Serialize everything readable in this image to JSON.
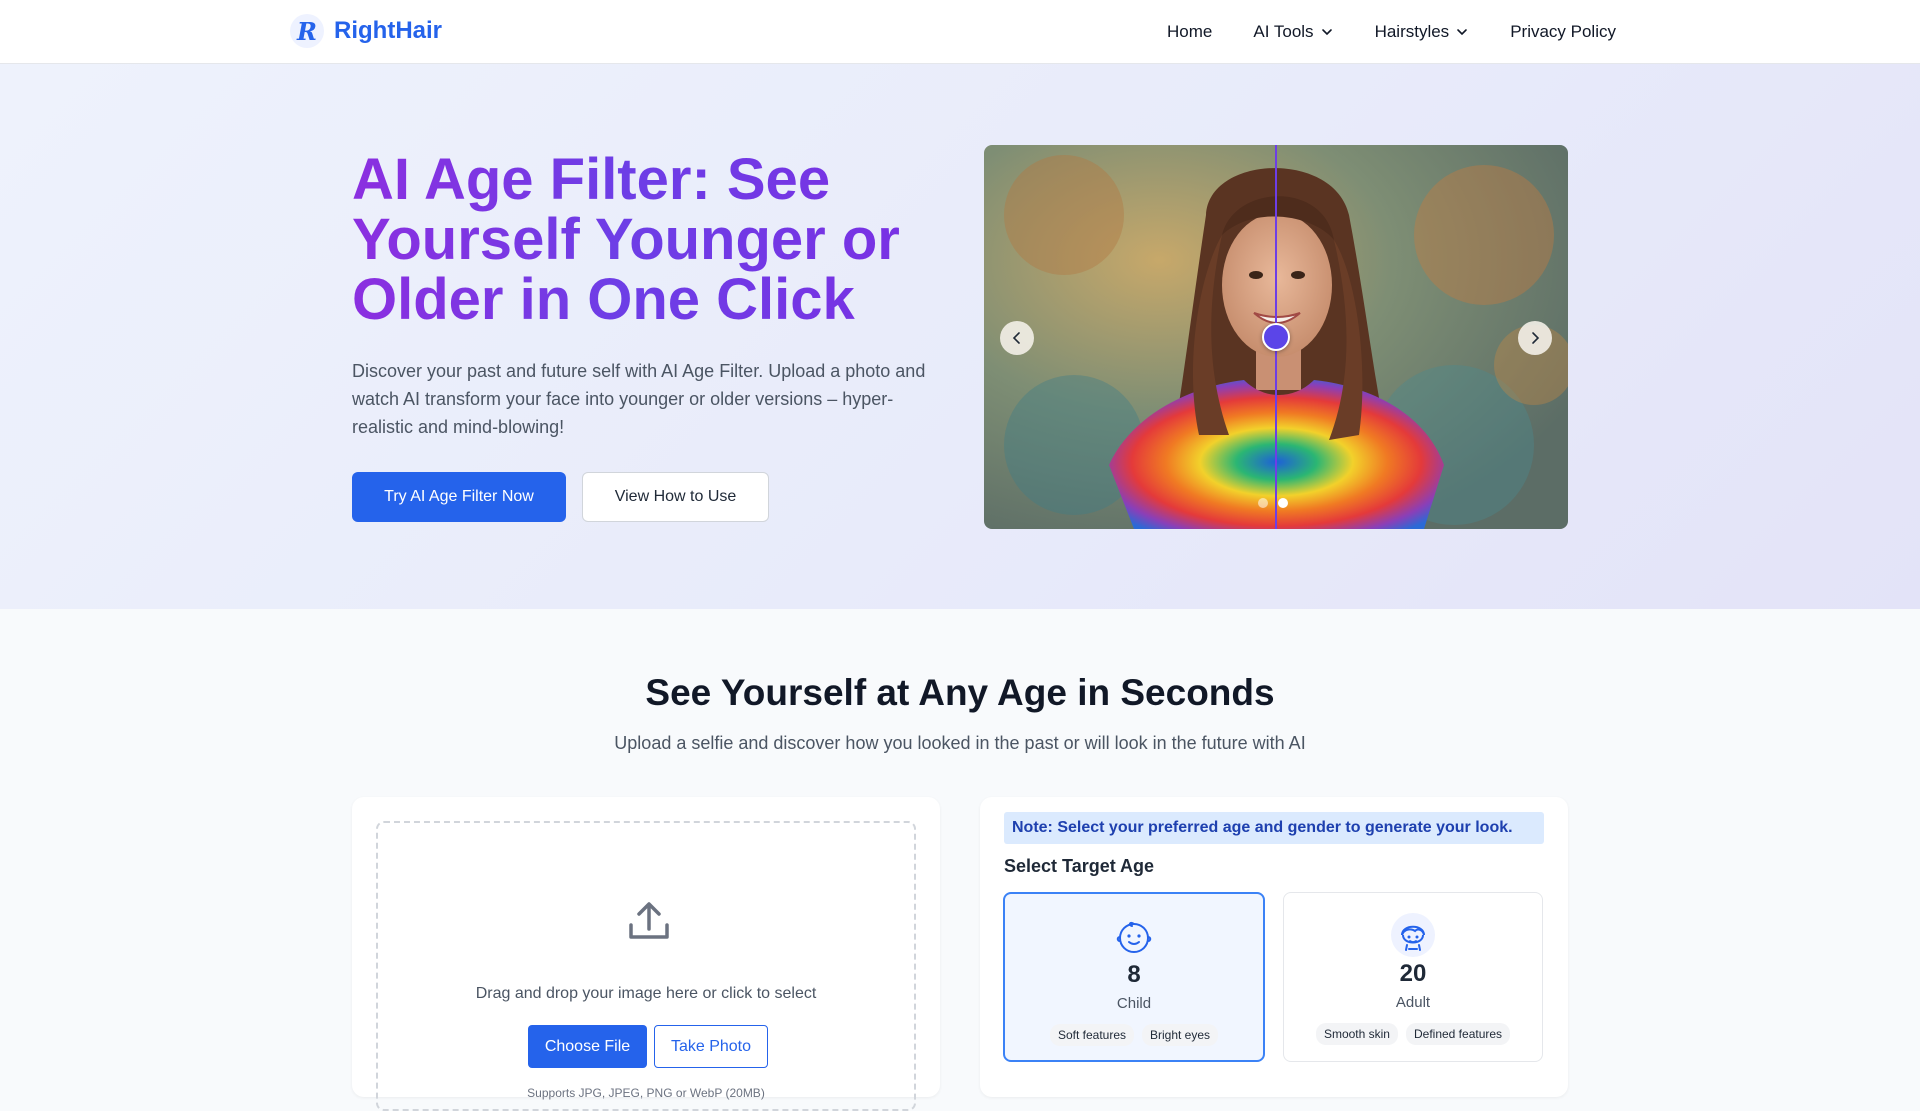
{
  "brand": {
    "logo_letter": "R",
    "name": "RightHair",
    "accent": "#2563eb"
  },
  "nav": {
    "items": [
      {
        "label": "Home"
      },
      {
        "label": "AI Tools"
      },
      {
        "label": "Hairstyles"
      },
      {
        "label": "Privacy Policy"
      }
    ]
  },
  "hero": {
    "title": "AI Age Filter: See Yourself Younger or Older in One Click",
    "description": "Discover your past and future self with AI Age Filter. Upload a photo and watch AI transform your face into younger or older versions – hyper-realistic and mind-blowing!",
    "primary_button": "Try AI Age Filter Now",
    "secondary_button": "View How to Use",
    "title_gradient": [
      "#8b2fe0",
      "#6d3ee6"
    ],
    "slider": {
      "compare_position": 0.5,
      "slide_count": 2,
      "active_slide": 2
    }
  },
  "section": {
    "title": "See Yourself at Any Age in Seconds",
    "subtitle": "Upload a selfie and discover how you looked in the past or will look in the future with AI"
  },
  "upload": {
    "prompt": "Drag and drop your image here or click to select",
    "choose_button": "Choose File",
    "photo_button": "Take Photo",
    "supported": "Supports JPG, JPEG, PNG or WebP (20MB)",
    "icon": "upload-icon"
  },
  "options": {
    "note": "Note: Select your preferred age and gender to generate your look.",
    "select_label": "Select Target Age",
    "ages": [
      {
        "value": "8",
        "label": "Child",
        "tags": [
          "Soft features",
          "Bright eyes"
        ],
        "icon": "child-face-icon",
        "selected": true
      },
      {
        "value": "20",
        "label": "Adult",
        "tags": [
          "Smooth skin",
          "Defined features"
        ],
        "icon": "adult-face-icon",
        "selected": false
      }
    ]
  }
}
